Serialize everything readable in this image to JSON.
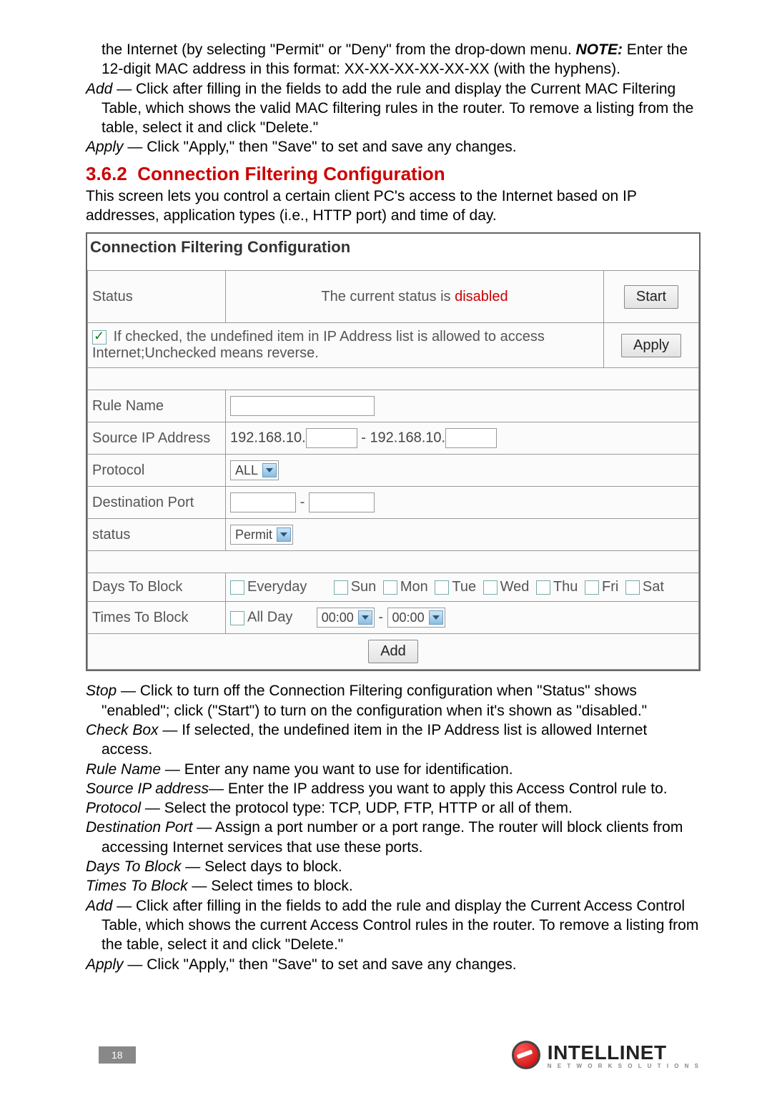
{
  "topParagraphs": {
    "line1_part1": "the Internet (by selecting \"Permit\" or \"Deny\" from the drop-down menu. ",
    "line1_note": "NOTE:",
    "line1_part2": " Enter the 12-digit MAC address in this format: XX-XX-XX-XX-XX-XX (with the hyphens).",
    "add_label": "Add",
    "add_text": " — Click after filling in the fields to add the rule and display the Current MAC Filtering Table, which shows the valid MAC filtering rules in the router. To remove a listing from the table, select it and click \"Delete.\"",
    "apply_label": "Apply",
    "apply_text": " — Click \"Apply,\" then \"Save\" to set and save any changes."
  },
  "section": {
    "number": "3.6.2",
    "title": "Connection Filtering Configuration",
    "intro": "This screen lets you control a certain client PC's access to the Internet based on IP addresses, application types (i.e., HTTP port) and time of day."
  },
  "configBox": {
    "title": "Connection Filtering Configuration",
    "statusLabel": "Status",
    "statusText1": "The current status is ",
    "statusText2": "disabled",
    "startBtn": "Start",
    "checkboxText": "If checked, the undefined item in IP Address list is allowed to access Internet;Unchecked means reverse.",
    "applyBtn": "Apply",
    "ruleNameLabel": "Rule Name",
    "sourceIpLabel": "Source IP Address",
    "ipPrefix1": "192.168.10.",
    "ipSep": " - ",
    "ipPrefix2": "192.168.10.",
    "protocolLabel": "Protocol",
    "protocolValue": "ALL",
    "destPortLabel": "Destination Port",
    "portSep": " - ",
    "statusFieldLabel": "status",
    "statusFieldValue": "Permit",
    "daysLabel": "Days To Block",
    "everyday": "Everyday",
    "days": [
      "Sun",
      "Mon",
      "Tue",
      "Wed",
      "Thu",
      "Fri",
      "Sat"
    ],
    "timesLabel": "Times To Block",
    "allDay": "All Day",
    "time1": "00:00",
    "timeSep": " - ",
    "time2": "00:00",
    "addBtn": "Add"
  },
  "definitions": [
    {
      "term": "Stop",
      "text": " — Click to turn off the Connection Filtering configuration when \"Status\" shows \"enabled\"; click (\"Start\") to turn on the configuration when it's shown as \"disabled.\""
    },
    {
      "term": "Check Box",
      "text": " — If selected, the undefined item in the IP Address list is allowed Internet access."
    },
    {
      "term": "Rule Name",
      "text": " — Enter any name you want to use for identification."
    },
    {
      "term": "Source IP address",
      "text": "— Enter the IP address you want to apply this Access Control rule to."
    },
    {
      "term": "Protocol",
      "text": " — Select the protocol type: TCP, UDP, FTP, HTTP or all of them."
    },
    {
      "term": "Destination Port",
      "text": " — Assign a port number or a port range. The router will block clients from accessing Internet services that use these ports."
    },
    {
      "term": "Days To Block",
      "text": " — Select days to block."
    },
    {
      "term": "Times To Block",
      "text": " — Select times to block."
    },
    {
      "term": "Add",
      "text": " — Click after filling in the fields to add the rule and display the Current Access Control Table, which shows the current Access Control rules in the router. To remove a listing from the table, select it and click \"Delete.\""
    },
    {
      "term": "Apply",
      "text": " — Click \"Apply,\" then \"Save\" to set and save any changes."
    }
  ],
  "footer": {
    "pageNum": "18",
    "brand": "INTELLINET",
    "sub": "N E T W O R K   S O L U T I O N S"
  }
}
